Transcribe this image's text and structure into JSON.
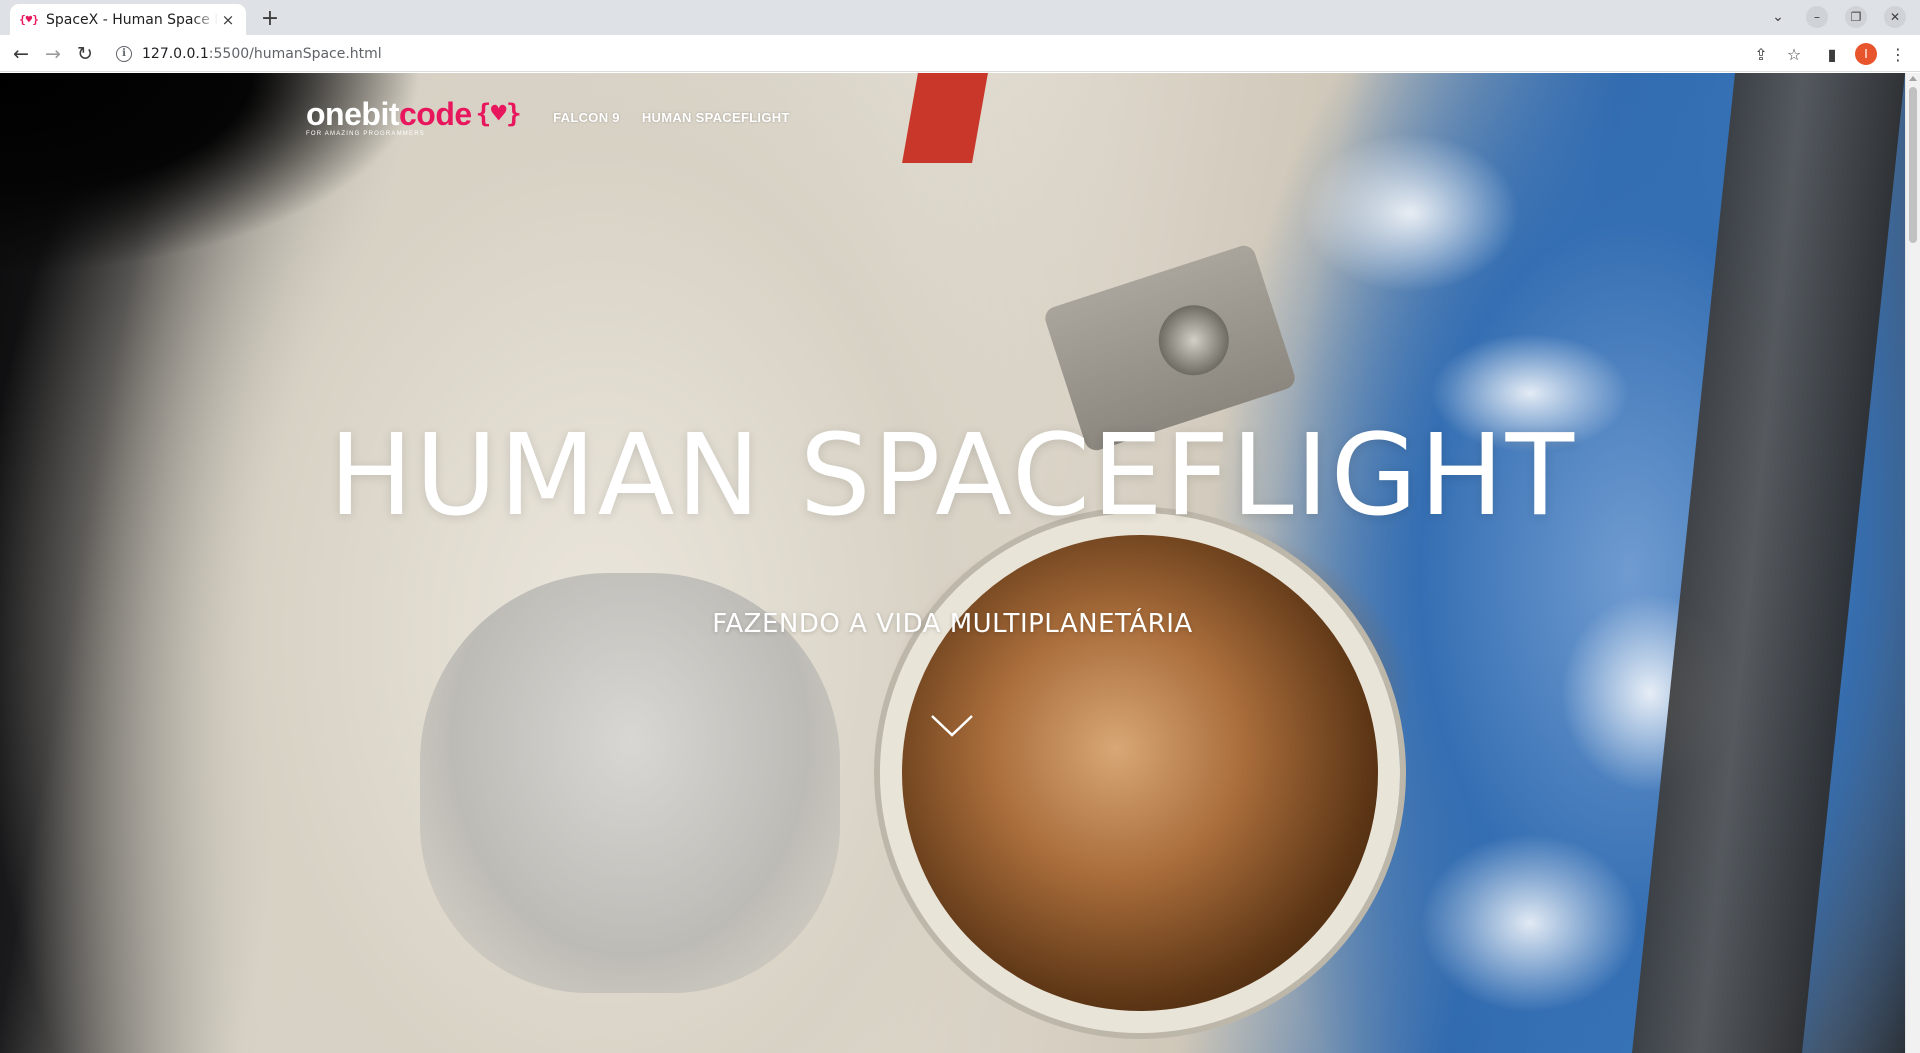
{
  "browser": {
    "tab": {
      "favicon": "{♥}",
      "title": "SpaceX - Human Space Flight",
      "close_icon": "×"
    },
    "new_tab_icon": "+",
    "window_controls": {
      "tab_search_icon": "⌄",
      "minimize_icon": "–",
      "restore_icon": "❐",
      "close_icon": "✕"
    },
    "nav": {
      "back_icon": "←",
      "forward_icon": "→",
      "reload_icon": "↻"
    },
    "address": {
      "host": "127.0.0.1",
      "rest": ":5500/humanSpace.html"
    },
    "toolbar_icons": {
      "share_icon": "⇪",
      "bookmark_icon": "☆",
      "sidepanel_icon": "▮",
      "profile_initial": "I",
      "menu_icon": "⋮"
    }
  },
  "site": {
    "logo": {
      "part1": "onebit",
      "part2": "code",
      "brace": "{♥}",
      "tagline": "FOR AMAZING PROGRAMMERS"
    },
    "nav": [
      {
        "label": "FALCON 9"
      },
      {
        "label": "HUMAN SPACEFLIGHT"
      }
    ]
  },
  "hero": {
    "title": "HUMAN SPACEFLIGHT",
    "subtitle": "FAZENDO A VIDA MULTIPLANETÁRIA",
    "scroll_icon": "chevron-down-icon"
  },
  "colors": {
    "brand_accent": "#e8175d",
    "hero_text": "#ffffff",
    "tabstrip_bg": "#dee1e6"
  }
}
